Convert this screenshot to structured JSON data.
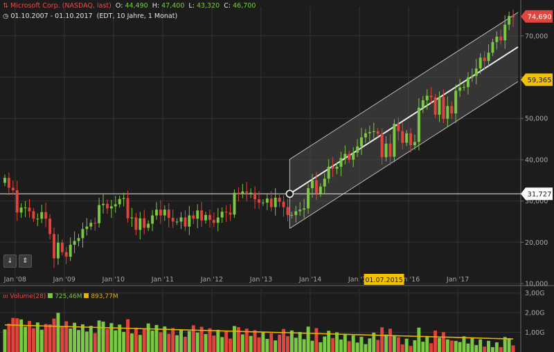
{
  "header": {
    "instrument": "Microsoft Corp. (NASDAQ, last)",
    "open_label": "O:",
    "open": "44,490",
    "high_label": "H:",
    "high": "47,400",
    "low_label": "L:",
    "low": "43,320",
    "close_label": "C:",
    "close": "46,700",
    "date_range": "01.10.2007 - 01.10.2017",
    "period": "(EDT, 10 Jahre, 1 Monat)"
  },
  "volume_legend": {
    "label": "Volume(28)",
    "value1": "725,46M",
    "value2": "893,77M"
  },
  "controls": {
    "down_icon": "↓",
    "fit_icon": "⇕"
  },
  "colors": {
    "background": "#1c1c1c",
    "up": "#7ac943",
    "down": "#e0443c",
    "grid": "#333333",
    "ma": "#e8b400",
    "channel_fill": "#4a4a4a",
    "current_price_label": "#e0443c",
    "channel_price_label": "#f2c200"
  },
  "chart_data": {
    "type": "candlestick",
    "title": "Microsoft Corp. (NASDAQ, last)",
    "interval": "1 Monat",
    "y_axis_ticks": [
      "70,000",
      "60,000",
      "50,000",
      "40,000",
      "30,000",
      "20,000",
      "10,000"
    ],
    "y_axis_tick_values": [
      70,
      60,
      50,
      40,
      30,
      20,
      10
    ],
    "ylim": [
      10,
      77
    ],
    "x_tick_labels": [
      "Jan '08",
      "Jan '09",
      "Jan '10",
      "Jan '11",
      "Jan '12",
      "Jan '13",
      "Jan '14",
      "Jan '15",
      "Jan '16",
      "Jan '17"
    ],
    "x_tick_dates": [
      "2008-01",
      "2009-01",
      "2010-01",
      "2011-01",
      "2012-01",
      "2013-01",
      "2014-01",
      "2015-01",
      "2016-01",
      "2017-01"
    ],
    "xlim": [
      "2007-10",
      "2017-11"
    ],
    "closes": [
      35.6,
      33.2,
      32.6,
      27.2,
      28.4,
      28.4,
      27.5,
      25.7,
      25.7,
      27.3,
      25.7,
      22.0,
      16.1,
      19.9,
      17.6,
      16.5,
      19.4,
      20.3,
      21.0,
      23.2,
      23.8,
      24.7,
      24.6,
      29.0,
      29.3,
      28.2,
      28.7,
      29.2,
      30.5,
      30.7,
      25.8,
      26.0,
      23.0,
      25.8,
      23.5,
      24.5,
      26.5,
      27.9,
      26.5,
      27.9,
      25.9,
      25.0,
      25.0,
      26.0,
      23.8,
      26.5,
      25.7,
      27.7,
      25.3,
      26.6,
      25.4,
      24.7,
      26.0,
      27.4,
      27.2,
      26.7,
      32.0,
      31.7,
      32.3,
      32.0,
      32.0,
      30.4,
      29.6,
      29.6,
      30.6,
      28.5,
      30.8,
      29.8,
      28.5,
      26.6,
      26.6,
      27.5,
      27.9,
      28.2,
      33.1,
      35.0,
      31.8,
      33.5,
      35.4,
      38.3,
      37.8,
      38.3,
      40.4,
      41.4,
      40.0,
      41.7,
      43.2,
      45.4,
      46.4,
      46.7,
      46.9,
      46.3,
      40.6,
      43.9,
      40.7,
      48.7,
      46.9,
      44.1,
      46.4,
      43.5,
      44.3,
      52.6,
      54.4,
      55.5,
      55.1,
      50.9,
      55.2,
      49.9,
      53.0,
      51.2,
      56.7,
      57.5,
      57.6,
      59.9,
      60.3,
      62.1,
      64.7,
      63.9,
      65.9,
      68.5,
      69.8,
      68.9,
      72.7,
      74.8,
      74.5
    ],
    "current_price_label": "74,690",
    "channel_mid_label": "59,365",
    "horizontal_line_label": "31,727",
    "highlight_date_label": "01.07.2015",
    "volume_axis_ticks": [
      "3,00G",
      "2,00G",
      "1,00G"
    ],
    "volume_ylim": [
      0,
      3.2
    ],
    "volume_ma": 0.89
  }
}
